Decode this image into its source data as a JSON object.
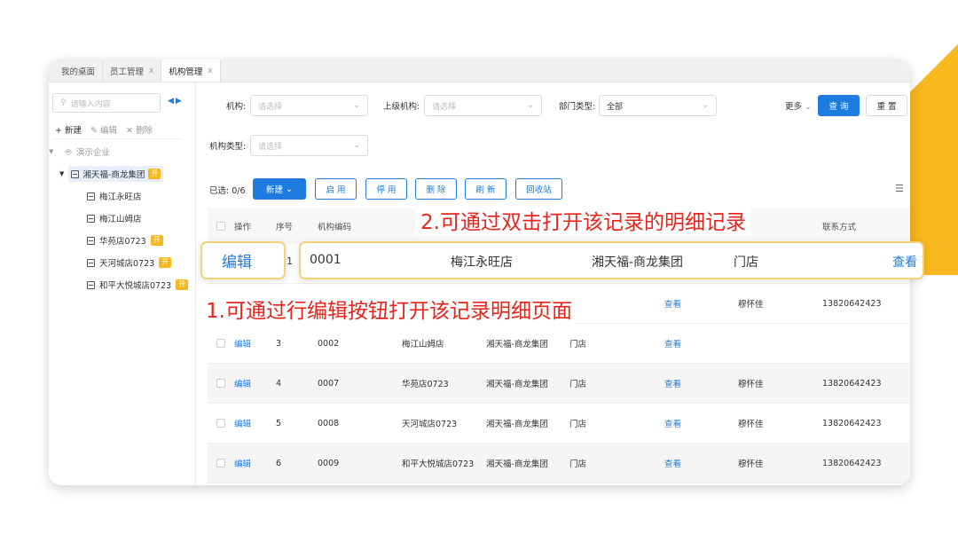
{
  "tabs": [
    {
      "label": "我的桌面",
      "closable": false,
      "active": false
    },
    {
      "label": "员工管理",
      "closable": true,
      "active": false
    },
    {
      "label": "机构管理",
      "closable": true,
      "active": true
    }
  ],
  "tab_close_glyph": "x",
  "sidebar": {
    "search_placeholder": "请输入内容",
    "actions": {
      "new": "+ 新建",
      "edit": "编辑",
      "delete": "删除"
    },
    "root": "演示企业",
    "group": "湘天福-商龙集团",
    "badge": "开",
    "stores": [
      {
        "label": "梅江永旺店",
        "badge": false
      },
      {
        "label": "梅江山姆店",
        "badge": false
      },
      {
        "label": "华苑店0723",
        "badge": true
      },
      {
        "label": "天河城店0723",
        "badge": true
      },
      {
        "label": "和平大悦城店0723",
        "badge": true
      }
    ]
  },
  "filters": {
    "org_label": "机构:",
    "org_placeholder": "请选择",
    "parent_label": "上级机构:",
    "parent_placeholder": "请选择",
    "dept_type_label": "部门类型:",
    "dept_type_value": "全部",
    "org_type_label": "机构类型:",
    "org_type_placeholder": "请选择",
    "more": "更多",
    "query": "查 询",
    "reset": "重 置"
  },
  "toolbar": {
    "selected": "已选: 0/6",
    "new": "新建",
    "enable": "启 用",
    "disable": "停 用",
    "delete": "删 除",
    "refresh": "刷 新",
    "recycle": "回收站"
  },
  "table": {
    "headers": [
      "操作",
      "序号",
      "机构编码",
      "",
      "",
      "",
      "",
      "",
      "联系方式"
    ],
    "rows": [
      {
        "op": "编辑",
        "idx": "3",
        "code": "0002",
        "name": "梅江山姆店",
        "parent": "湘天福-商龙集团",
        "type": "门店",
        "detail": "查看",
        "mgr": "",
        "tel": ""
      },
      {
        "op": "编辑",
        "idx": "4",
        "code": "0007",
        "name": "华苑店0723",
        "parent": "湘天福-商龙集团",
        "type": "门店",
        "detail": "查看",
        "mgr": "穆怀佳",
        "tel": "13820642423"
      },
      {
        "op": "编辑",
        "idx": "5",
        "code": "0008",
        "name": "天河城店0723",
        "parent": "湘天福-商龙集团",
        "type": "门店",
        "detail": "查看",
        "mgr": "穆怀佳",
        "tel": "13820642423"
      },
      {
        "op": "编辑",
        "idx": "6",
        "code": "0009",
        "name": "和平大悦城店0723",
        "parent": "湘天福-商龙集团",
        "type": "门店",
        "detail": "查看",
        "mgr": "穆怀佳",
        "tel": "13820642423"
      }
    ],
    "row2": {
      "detail": "查看",
      "mgr": "穆怀佳",
      "tel": "13820642423"
    }
  },
  "highlight": {
    "edit": "编辑",
    "idx": "1",
    "code": "0001",
    "name": "梅江永旺店",
    "parent": "湘天福-商龙集团",
    "type": "门店",
    "detail": "查看"
  },
  "annotations": {
    "top": "2.可通过双击打开该记录的明细记录",
    "bottom": "1.可通过行编辑按钮打开该记录明细页面"
  },
  "colors": {
    "accent": "#1e7be0",
    "annotation": "#e8231b",
    "badge": "#f6b81c"
  }
}
